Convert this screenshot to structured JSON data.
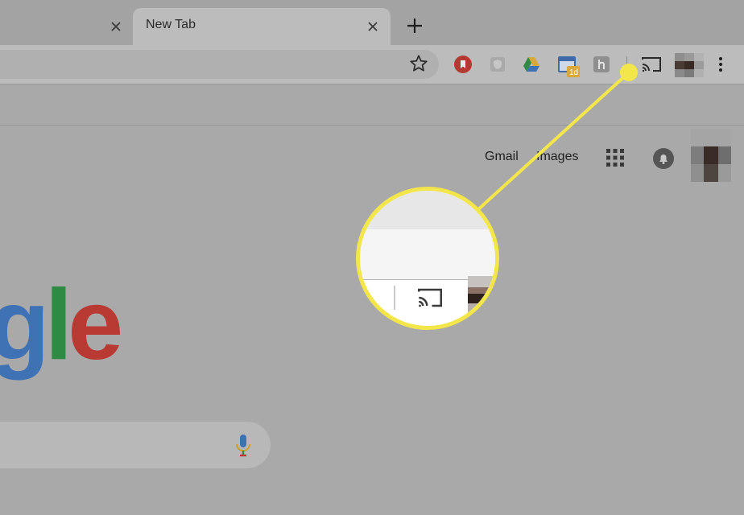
{
  "tabs": [
    {
      "title": ""
    },
    {
      "title": "New Tab"
    }
  ],
  "google_header": {
    "gmail": "Gmail",
    "images": "Images"
  },
  "logo": {
    "g": "g",
    "l": "l",
    "e": "e"
  },
  "icons": {
    "close": "close-icon",
    "new_tab": "plus-icon",
    "bookmark_star": "star-icon",
    "cast": "cast-icon",
    "menu": "three-dots-vertical-icon",
    "apps": "apps-grid-icon",
    "notifications": "bell-icon",
    "voice_search": "microphone-icon"
  },
  "colors": {
    "callout": "#f3e64a",
    "google_blue": "#3f72b5",
    "google_green": "#2f8a43",
    "google_red": "#b83a32"
  }
}
